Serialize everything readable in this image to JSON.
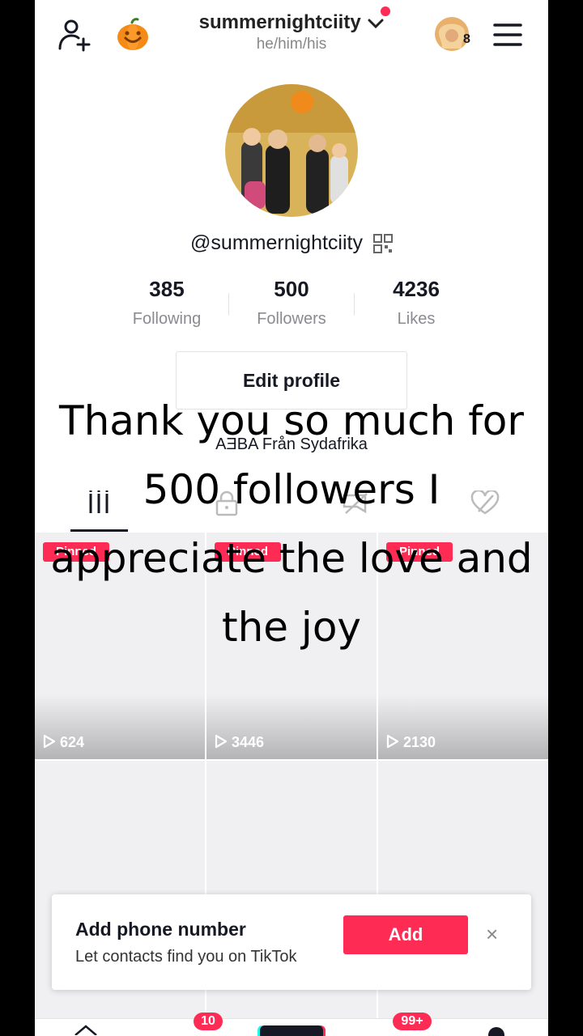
{
  "header": {
    "username": "summernightciity",
    "pronouns": "he/him/his",
    "avatar_badge_count": "8"
  },
  "profile": {
    "handle": "@summernightciity",
    "bio": "AƎBA Från Sydafrika",
    "edit_profile_label": "Edit profile"
  },
  "stats": [
    {
      "value": "385",
      "label": "Following"
    },
    {
      "value": "500",
      "label": "Followers"
    },
    {
      "value": "4236",
      "label": "Likes"
    }
  ],
  "grid": {
    "row1": [
      {
        "badge": "Pinned",
        "views": "624"
      },
      {
        "badge": "Pinned",
        "views": "3446"
      },
      {
        "badge": "Pinned",
        "views": "2130"
      }
    ]
  },
  "caption": {
    "lines": [
      "Thank you so much for",
      "500 followers I",
      "appreciate the love and",
      "the joy"
    ]
  },
  "banner": {
    "title": "Add phone number",
    "subtitle": "Let contacts find you on TikTok",
    "add_label": "Add",
    "close_glyph": "×"
  },
  "bottom_nav": {
    "inbox_badge": "10",
    "activity_badge": "99+"
  },
  "colors": {
    "accent": "#fe2c55",
    "text": "#161823",
    "muted": "#8a8b91"
  }
}
